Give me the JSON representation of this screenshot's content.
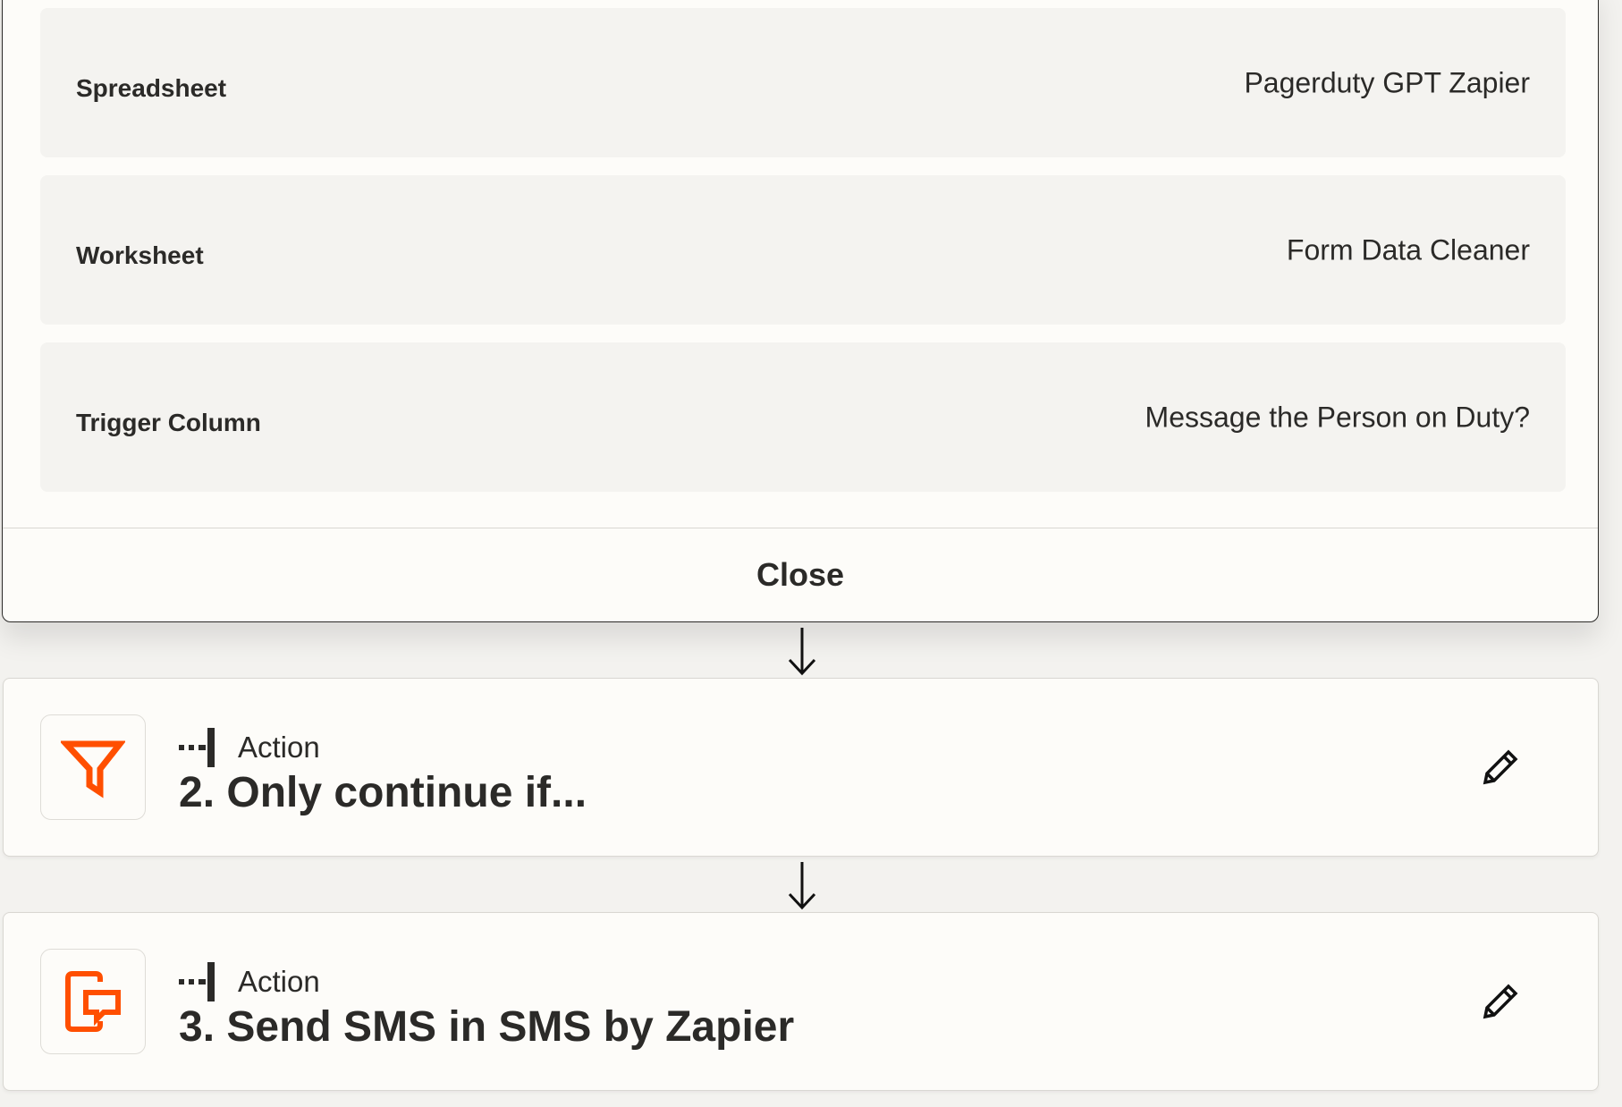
{
  "modal": {
    "fields": [
      {
        "label": "Spreadsheet",
        "value": "Pagerduty GPT Zapier"
      },
      {
        "label": "Worksheet",
        "value": "Form Data Cleaner"
      },
      {
        "label": "Trigger Column",
        "value": "Message the Person on Duty?"
      }
    ],
    "close_label": "Close"
  },
  "steps": [
    {
      "kind": "Action",
      "title": "2. Only continue if...",
      "icon": "filter-icon"
    },
    {
      "kind": "Action",
      "title": "3. Send SMS in SMS by Zapier",
      "icon": "sms-icon"
    }
  ],
  "colors": {
    "accent": "#ff4f00",
    "text": "#2b2a28",
    "field_bg": "#f4f3f0",
    "card_bg": "#fdfcf9"
  }
}
